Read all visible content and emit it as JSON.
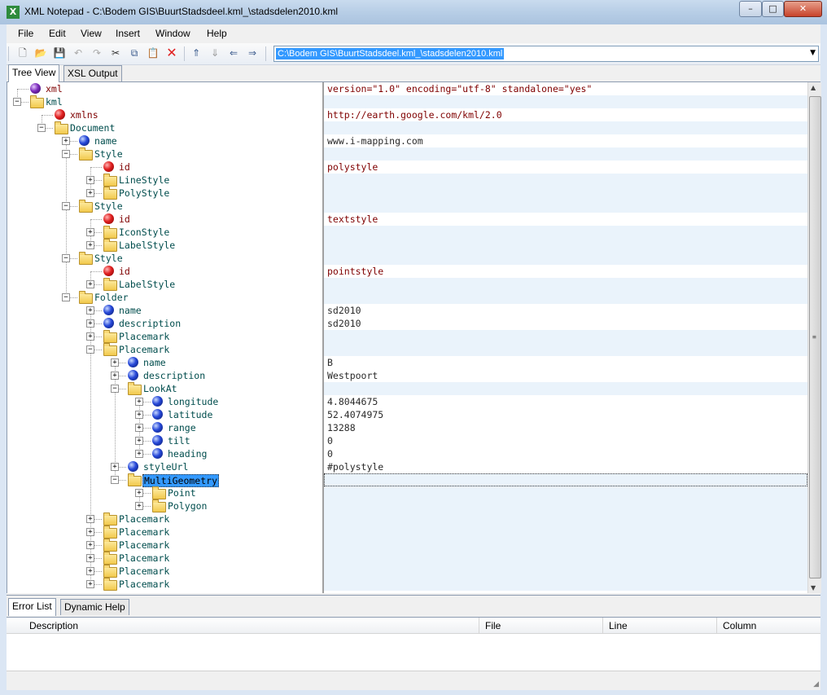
{
  "window": {
    "title": "XML Notepad - C:\\Bodem GIS\\BuurtStadsdeel.kml_\\stadsdelen2010.kml",
    "app_icon": "X",
    "minimize": "–",
    "maximize": "□",
    "close": "✕"
  },
  "menu": {
    "file": "File",
    "edit": "Edit",
    "view": "View",
    "insert": "Insert",
    "window": "Window",
    "help": "Help"
  },
  "toolbar": {
    "path": "C:\\Bodem GIS\\BuurtStadsdeel.kml_\\stadsdelen2010.kml",
    "icons": [
      "new-icon",
      "open-icon",
      "save-icon",
      "undo-icon",
      "redo-icon",
      "cut-icon",
      "copy-icon",
      "paste-icon",
      "delete-icon",
      "nudge-up-icon",
      "nudge-down-icon",
      "nudge-left-icon",
      "nudge-right-icon"
    ]
  },
  "tabs_top": [
    "Tree View",
    "XSL Output"
  ],
  "tree": [
    {
      "label": "xml",
      "type": "pi",
      "depth": 0,
      "expander": "",
      "value": "version=\"1.0\" encoding=\"utf-8\" standalone=\"yes\""
    },
    {
      "label": "kml",
      "type": "folder",
      "depth": 0,
      "expander": "−",
      "value": ""
    },
    {
      "label": "xmlns",
      "type": "attr",
      "depth": 1,
      "expander": "",
      "value": "http://earth.google.com/kml/2.0"
    },
    {
      "label": "Document",
      "type": "folder",
      "depth": 1,
      "expander": "−",
      "value": ""
    },
    {
      "label": "name",
      "type": "elem",
      "depth": 2,
      "expander": "+",
      "value": "www.i-mapping.com"
    },
    {
      "label": "Style",
      "type": "folder",
      "depth": 2,
      "expander": "−",
      "value": ""
    },
    {
      "label": "id",
      "type": "attr",
      "depth": 3,
      "expander": "",
      "value": "polystyle"
    },
    {
      "label": "LineStyle",
      "type": "folder",
      "depth": 3,
      "expander": "+",
      "value": ""
    },
    {
      "label": "PolyStyle",
      "type": "folder",
      "depth": 3,
      "expander": "+",
      "value": ""
    },
    {
      "label": "Style",
      "type": "folder",
      "depth": 2,
      "expander": "−",
      "value": ""
    },
    {
      "label": "id",
      "type": "attr",
      "depth": 3,
      "expander": "",
      "value": "textstyle"
    },
    {
      "label": "IconStyle",
      "type": "folder",
      "depth": 3,
      "expander": "+",
      "value": ""
    },
    {
      "label": "LabelStyle",
      "type": "folder",
      "depth": 3,
      "expander": "+",
      "value": ""
    },
    {
      "label": "Style",
      "type": "folder",
      "depth": 2,
      "expander": "−",
      "value": ""
    },
    {
      "label": "id",
      "type": "attr",
      "depth": 3,
      "expander": "",
      "value": "pointstyle"
    },
    {
      "label": "LabelStyle",
      "type": "folder",
      "depth": 3,
      "expander": "+",
      "value": ""
    },
    {
      "label": "Folder",
      "type": "folder",
      "depth": 2,
      "expander": "−",
      "value": ""
    },
    {
      "label": "name",
      "type": "elem",
      "depth": 3,
      "expander": "+",
      "value": "sd2010"
    },
    {
      "label": "description",
      "type": "elem",
      "depth": 3,
      "expander": "+",
      "value": "sd2010"
    },
    {
      "label": "Placemark",
      "type": "folder",
      "depth": 3,
      "expander": "+",
      "value": ""
    },
    {
      "label": "Placemark",
      "type": "folder",
      "depth": 3,
      "expander": "−",
      "value": ""
    },
    {
      "label": "name",
      "type": "elem",
      "depth": 4,
      "expander": "+",
      "value": "B"
    },
    {
      "label": "description",
      "type": "elem",
      "depth": 4,
      "expander": "+",
      "value": "Westpoort"
    },
    {
      "label": "LookAt",
      "type": "folder",
      "depth": 4,
      "expander": "−",
      "value": ""
    },
    {
      "label": "longitude",
      "type": "elem",
      "depth": 5,
      "expander": "+",
      "value": "4.8044675"
    },
    {
      "label": "latitude",
      "type": "elem",
      "depth": 5,
      "expander": "+",
      "value": "52.4074975"
    },
    {
      "label": "range",
      "type": "elem",
      "depth": 5,
      "expander": "+",
      "value": "13288"
    },
    {
      "label": "tilt",
      "type": "elem",
      "depth": 5,
      "expander": "+",
      "value": "0"
    },
    {
      "label": "heading",
      "type": "elem",
      "depth": 5,
      "expander": "+",
      "value": "0"
    },
    {
      "label": "styleUrl",
      "type": "elem",
      "depth": 4,
      "expander": "+",
      "value": "#polystyle"
    },
    {
      "label": "MultiGeometry",
      "type": "folder",
      "depth": 4,
      "expander": "−",
      "value": "",
      "selected": true
    },
    {
      "label": "Point",
      "type": "folder",
      "depth": 5,
      "expander": "+",
      "value": ""
    },
    {
      "label": "Polygon",
      "type": "folder",
      "depth": 5,
      "expander": "+",
      "value": ""
    },
    {
      "label": "Placemark",
      "type": "folder",
      "depth": 3,
      "expander": "+",
      "value": ""
    },
    {
      "label": "Placemark",
      "type": "folder",
      "depth": 3,
      "expander": "+",
      "value": ""
    },
    {
      "label": "Placemark",
      "type": "folder",
      "depth": 3,
      "expander": "+",
      "value": ""
    },
    {
      "label": "Placemark",
      "type": "folder",
      "depth": 3,
      "expander": "+",
      "value": ""
    },
    {
      "label": "Placemark",
      "type": "folder",
      "depth": 3,
      "expander": "+",
      "value": ""
    },
    {
      "label": "Placemark",
      "type": "folder",
      "depth": 3,
      "expander": "+",
      "value": ""
    }
  ],
  "tabs_bottom": [
    "Error List",
    "Dynamic Help"
  ],
  "error_list": {
    "columns": [
      "Description",
      "File",
      "Line",
      "Column"
    ]
  },
  "colors": {
    "selection": "#3399ff",
    "attr_text": "#7f0000",
    "alt_row": "#eaf3fb"
  }
}
